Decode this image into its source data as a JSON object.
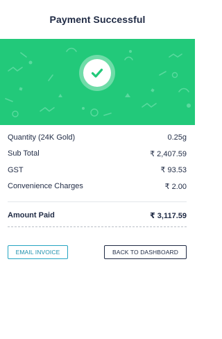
{
  "header": {
    "title": "Payment Successful"
  },
  "banner": {
    "status_icon": "check-icon",
    "bg_color": "#22c97a"
  },
  "details": {
    "rows": [
      {
        "label": "Quantity (24K Gold)",
        "value": "0.25g"
      },
      {
        "label": "Sub Total",
        "value": "₹ 2,407.59"
      },
      {
        "label": "GST",
        "value": "₹ 93.53"
      },
      {
        "label": "Convenience Charges",
        "value": "₹ 2.00"
      }
    ],
    "total": {
      "label": "Amount Paid",
      "value": "₹ 3,117.59"
    }
  },
  "actions": {
    "email_label": "EMAIL INVOICE",
    "dashboard_label": "BACK TO DASHBOARD"
  }
}
